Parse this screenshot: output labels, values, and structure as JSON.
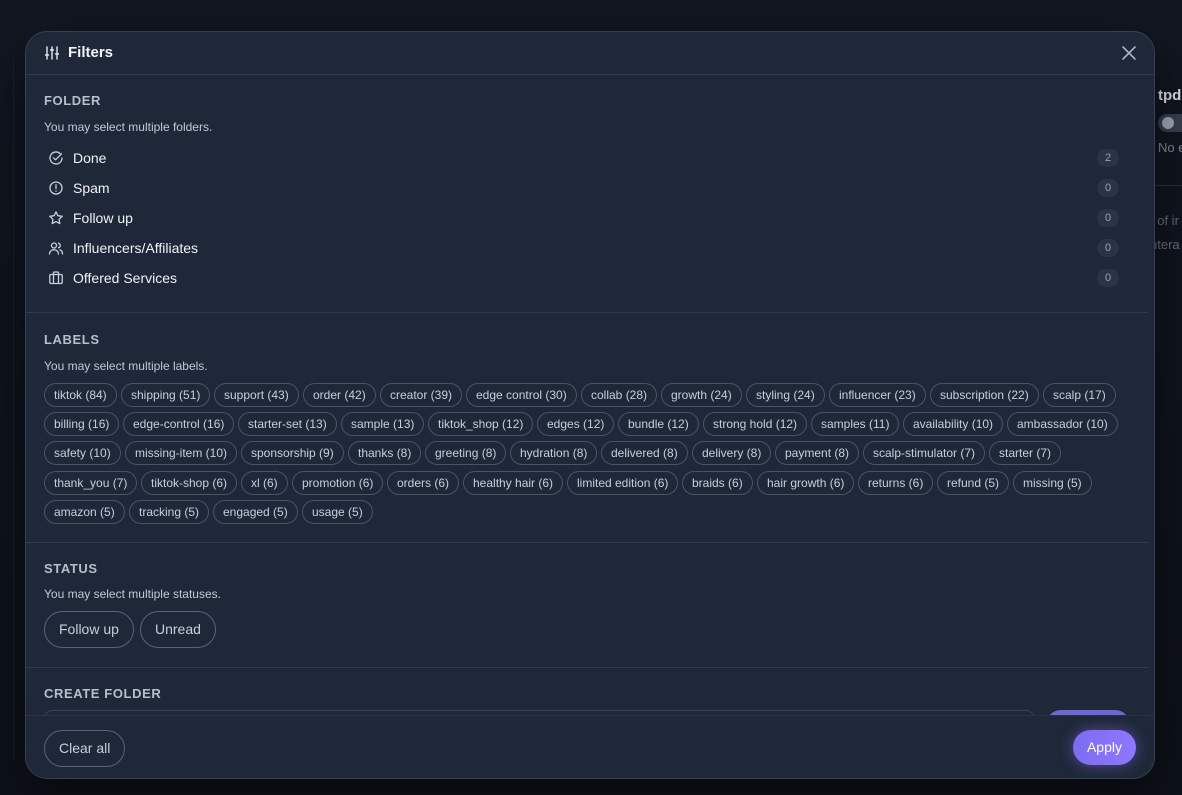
{
  "background": {
    "title": "tpdi",
    "sub": "No e",
    "line1": "t of ir",
    "line2": "ntera"
  },
  "modal": {
    "title": "Filters",
    "close_icon": "close-icon",
    "filters_icon": "sliders-icon"
  },
  "folder": {
    "title": "FOLDER",
    "description": "You may select multiple folders.",
    "items": [
      {
        "label": "Done",
        "count": "2",
        "icon": "check-circle-icon"
      },
      {
        "label": "Spam",
        "count": "0",
        "icon": "alert-circle-icon"
      },
      {
        "label": "Follow up",
        "count": "0",
        "icon": "star-icon"
      },
      {
        "label": "Influencers/Affiliates",
        "count": "0",
        "icon": "users-icon"
      },
      {
        "label": "Offered Services",
        "count": "0",
        "icon": "briefcase-icon"
      }
    ]
  },
  "labels": {
    "title": "LABELS",
    "description": "You may select multiple labels.",
    "rows": [
      [
        "tiktok (84)",
        "shipping (51)",
        "support (43)",
        "order (42)",
        "creator (39)",
        "edge control (30)",
        "collab (28)",
        "growth (24)",
        "styling (24)",
        "influencer (23)",
        "subscription (22)",
        "scalp (17)"
      ],
      [
        "billing (16)",
        "edge-control (16)",
        "starter-set (13)",
        "sample (13)",
        "tiktok_shop (12)",
        "edges (12)",
        "bundle (12)",
        "strong hold (12)",
        "samples (11)",
        "availability (10)",
        "ambassador (10)"
      ],
      [
        "safety (10)",
        "missing-item (10)",
        "sponsorship (9)",
        "thanks (8)",
        "greeting (8)",
        "hydration (8)",
        "delivered (8)",
        "delivery (8)",
        "payment (8)",
        "scalp-stimulator (7)",
        "starter (7)"
      ],
      [
        "thank_you (7)",
        "tiktok-shop (6)",
        "xl (6)",
        "promotion (6)",
        "orders (6)",
        "healthy hair (6)",
        "limited edition (6)",
        "braids (6)",
        "hair growth (6)",
        "returns (6)",
        "refund (5)",
        "missing (5)"
      ],
      [
        "amazon (5)",
        "tracking (5)",
        "engaged (5)",
        "usage (5)"
      ]
    ]
  },
  "status": {
    "title": "STATUS",
    "description": "You may select multiple statuses.",
    "items": [
      "Follow up",
      "Unread"
    ]
  },
  "create_folder": {
    "title": "CREATE FOLDER"
  },
  "footer": {
    "clear_label": "Clear all",
    "apply_label": "Apply"
  },
  "colors": {
    "modal_bg": "#1f2838",
    "accent": "#7c6cf0",
    "chip_border": "#4a5466"
  }
}
